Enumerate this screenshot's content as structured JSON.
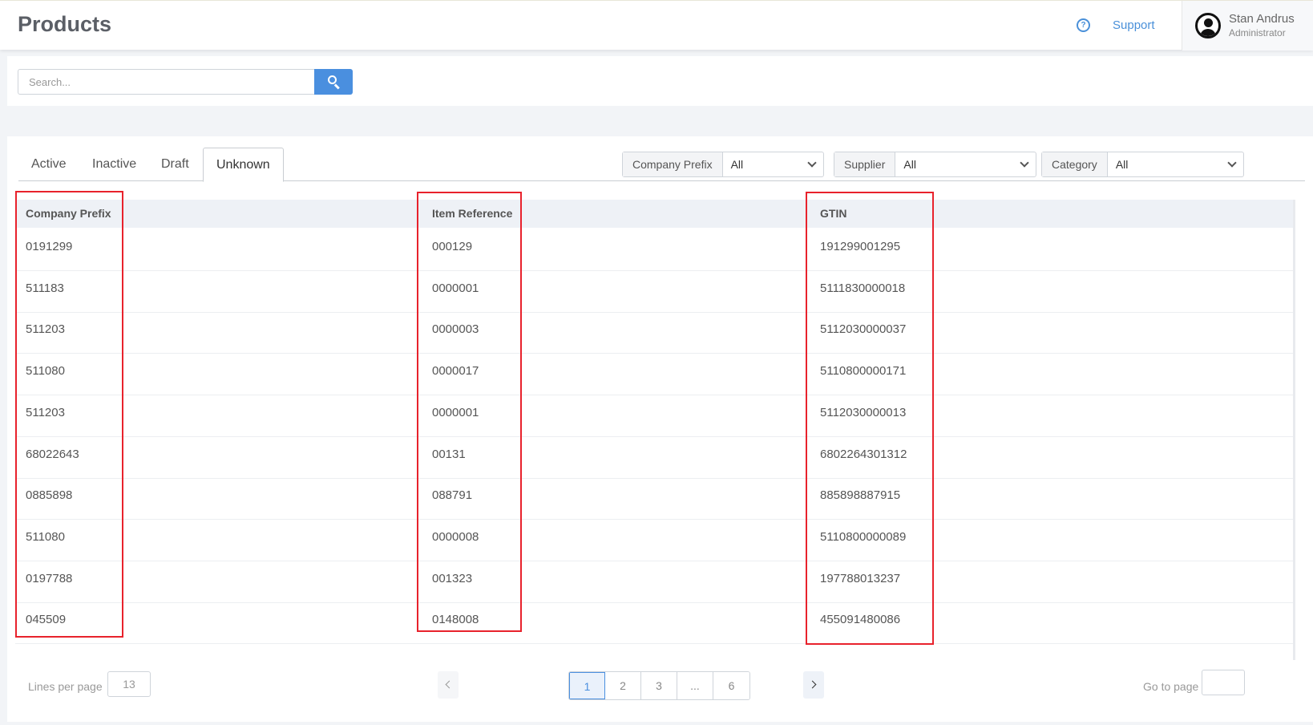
{
  "header": {
    "title": "Products",
    "support_label": "Support",
    "help_glyph": "?",
    "user": {
      "name": "Stan Andrus",
      "role": "Administrator"
    }
  },
  "search": {
    "placeholder": "Search..."
  },
  "tabs": [
    {
      "label": "Active"
    },
    {
      "label": "Inactive"
    },
    {
      "label": "Draft"
    },
    {
      "label": "Unknown",
      "active": true
    }
  ],
  "filters": [
    {
      "label": "Company Prefix",
      "value": "All"
    },
    {
      "label": "Supplier",
      "value": "All"
    },
    {
      "label": "Category",
      "value": "All"
    }
  ],
  "table": {
    "columns": [
      "Company Prefix",
      "Item Reference",
      "GTIN"
    ],
    "rows": [
      [
        "0191299",
        "000129",
        "191299001295"
      ],
      [
        "511183",
        "0000001",
        "5111830000018"
      ],
      [
        "511203",
        "0000003",
        "5112030000037"
      ],
      [
        "511080",
        "0000017",
        "5110800000171"
      ],
      [
        "511203",
        "0000001",
        "5112030000013"
      ],
      [
        "68022643",
        "00131",
        "6802264301312"
      ],
      [
        "0885898",
        "088791",
        "885898887915"
      ],
      [
        "511080",
        "0000008",
        "5110800000089"
      ],
      [
        "0197788",
        "001323",
        "197788013237"
      ],
      [
        "045509",
        "0148008",
        "455091480086"
      ]
    ]
  },
  "pagination": {
    "lines_per_page_label": "Lines per page",
    "lines_per_page": "13",
    "pages": [
      "1",
      "2",
      "3",
      "...",
      "6"
    ],
    "current_page": "1",
    "goto_label": "Go to page"
  },
  "colors": {
    "accent": "#4a8fdf",
    "highlight": "#e8222c"
  }
}
